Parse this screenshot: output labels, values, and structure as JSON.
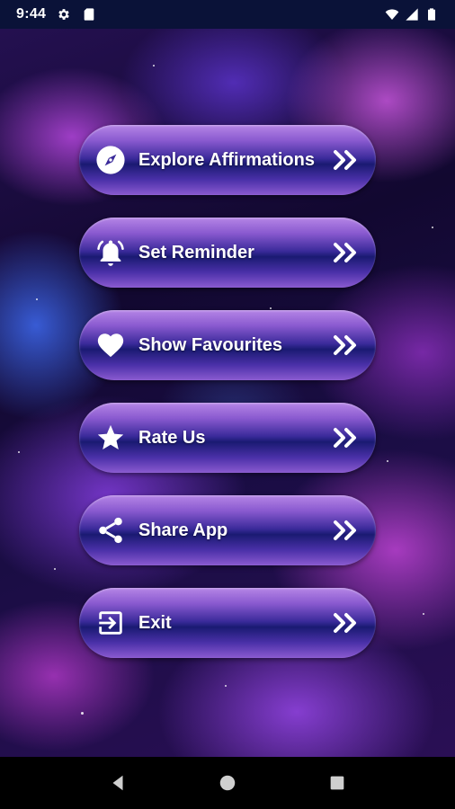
{
  "status_bar": {
    "time": "9:44",
    "left_icons": [
      "gear-icon",
      "sd-card-icon"
    ],
    "right_icons": [
      "wifi-icon",
      "cell-signal-icon",
      "battery-icon"
    ]
  },
  "menu": {
    "items": [
      {
        "label": "Explore Affirmations",
        "icon": "compass-icon"
      },
      {
        "label": "Set Reminder",
        "icon": "bell-icon"
      },
      {
        "label": "Show Favourites",
        "icon": "heart-icon"
      },
      {
        "label": "Rate Us",
        "icon": "star-icon"
      },
      {
        "label": "Share App",
        "icon": "share-icon"
      },
      {
        "label": "Exit",
        "icon": "exit-icon"
      }
    ],
    "arrow_icon": "double-chevron-right-icon"
  },
  "nav_bar": {
    "buttons": [
      "back-icon",
      "home-icon",
      "recents-icon"
    ]
  },
  "colors": {
    "status_bar_bg": "#0a1238",
    "button_top": "#b585e6",
    "button_middle": "#1a1a72",
    "text": "#ffffff"
  }
}
